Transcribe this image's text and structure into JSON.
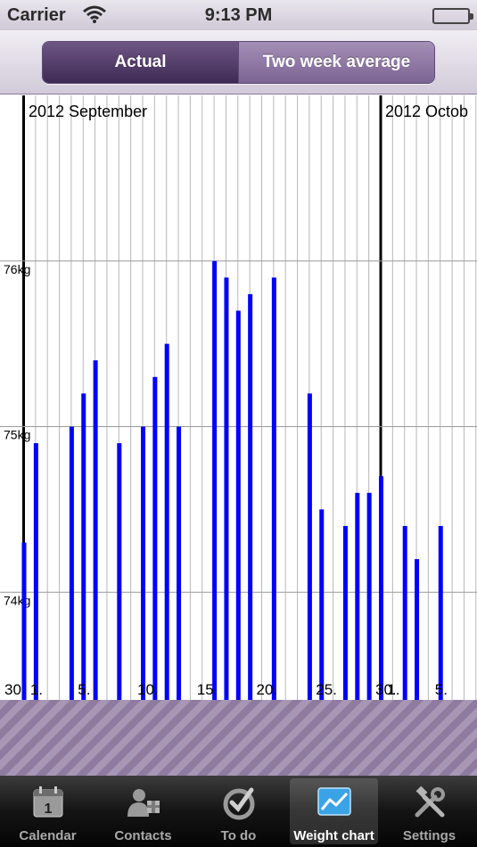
{
  "status_bar": {
    "carrier": "Carrier",
    "time": "9:13 PM"
  },
  "segmented_control": {
    "selected": "Actual",
    "options": [
      "Actual",
      "Two week average"
    ]
  },
  "chart_data": {
    "type": "bar",
    "title": "",
    "month_labels": [
      "2012 September",
      "2012 Octob"
    ],
    "day_tick_labels": [
      "30",
      "1.",
      "5.",
      "10.",
      "15.",
      "20.",
      "25.",
      "30.",
      "1.",
      "5."
    ],
    "y_tick_labels": [
      "76kg",
      "75kg",
      "74kg"
    ],
    "ylim": [
      73.35,
      77.0
    ],
    "xlabel": "",
    "ylabel": "",
    "grid": true,
    "bar_color": "#0000ff",
    "series": [
      {
        "days": [
          "Aug 30",
          "Sep 1",
          "Sep 4",
          "Sep 5",
          "Sep 6",
          "Sep 8",
          "Sep 10",
          "Sep 11",
          "Sep 12",
          "Sep 13",
          "Sep 16",
          "Sep 17",
          "Sep 18",
          "Sep 19",
          "Sep 21",
          "Sep 24",
          "Sep 25",
          "Sep 27",
          "Sep 28",
          "Sep 29",
          "Sep 30",
          "Oct 2",
          "Oct 3",
          "Oct 5"
        ],
        "values": [
          74.3,
          74.9,
          75.0,
          75.2,
          75.4,
          74.9,
          75.0,
          75.3,
          75.5,
          75.0,
          76.0,
          75.9,
          75.7,
          75.8,
          75.9,
          75.2,
          74.5,
          74.4,
          74.6,
          74.6,
          74.7,
          74.4,
          74.2,
          74.4
        ]
      }
    ]
  },
  "tab_bar": {
    "items": [
      {
        "label": "Calendar",
        "icon": "calendar-icon",
        "badge": "1"
      },
      {
        "label": "Contacts",
        "icon": "contacts-icon"
      },
      {
        "label": "To do",
        "icon": "todo-icon"
      },
      {
        "label": "Weight chart",
        "icon": "weight-chart-icon"
      },
      {
        "label": "Settings",
        "icon": "settings-icon"
      }
    ],
    "active_index": 3
  }
}
